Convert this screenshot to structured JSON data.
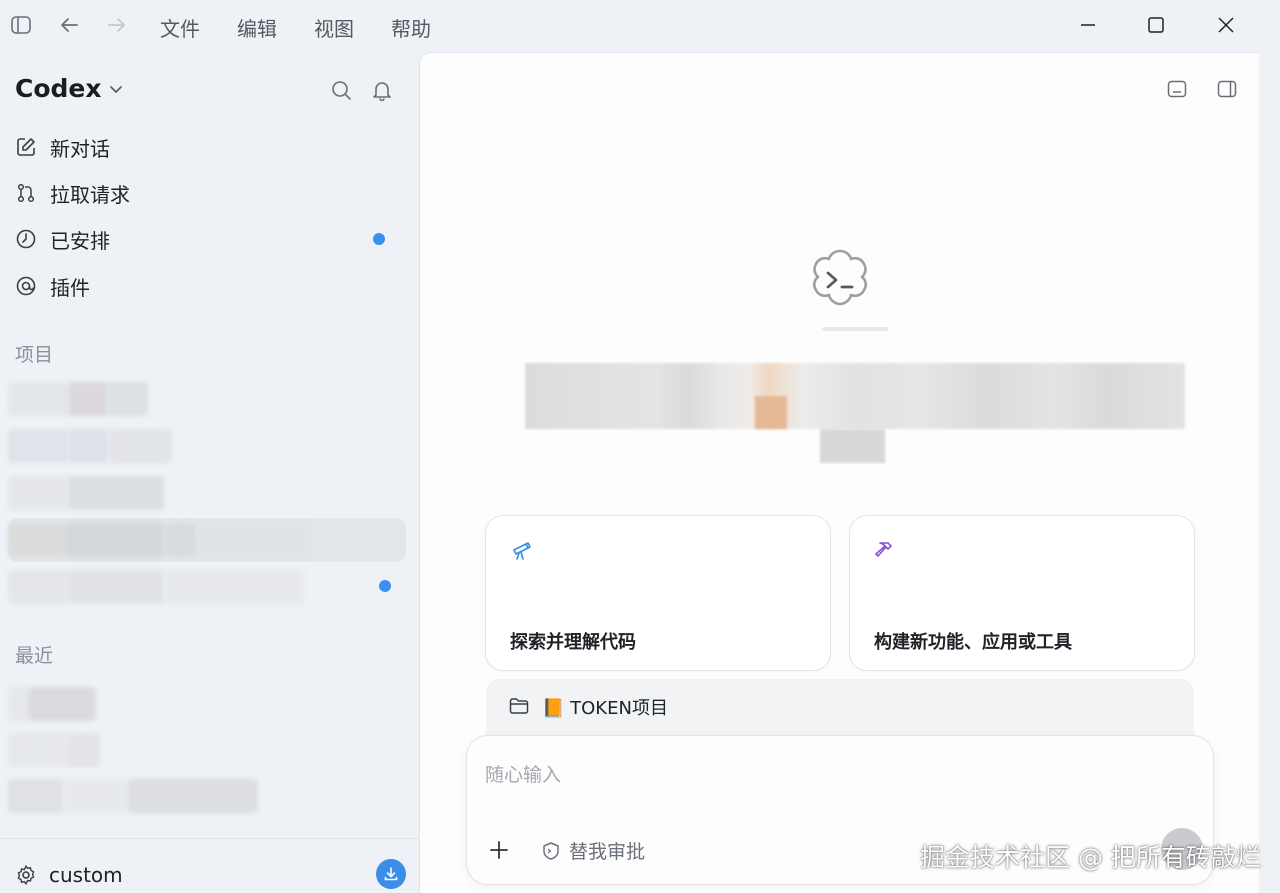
{
  "menu": {
    "file": "文件",
    "edit": "编辑",
    "view": "视图",
    "help": "帮助"
  },
  "sidebar": {
    "app_title": "Codex",
    "nav": [
      {
        "label": "新对话",
        "icon": "edit-icon"
      },
      {
        "label": "拉取请求",
        "icon": "git-pull-request-icon"
      },
      {
        "label": "已安排",
        "icon": "clock-icon"
      },
      {
        "label": "插件",
        "icon": "plugin-icon"
      }
    ],
    "projects_label": "项目",
    "recent_label": "最近",
    "settings_label": "custom"
  },
  "main": {
    "cards": [
      {
        "label": "探索并理解代码",
        "icon": "telescope-icon"
      },
      {
        "label": "构建新功能、应用或工具",
        "icon": "hammer-icon"
      }
    ],
    "project_label": "📙 TOKEN项目",
    "composer": {
      "placeholder": "随心输入",
      "approve_label": "替我审批"
    }
  },
  "watermark": "掘金技术社区 @ 把所有砖敲烂",
  "colors": {
    "accent": "#3b8ff0",
    "telescope_icon": "#2f8fe0",
    "hammer_icon": "#8a4fd8"
  }
}
